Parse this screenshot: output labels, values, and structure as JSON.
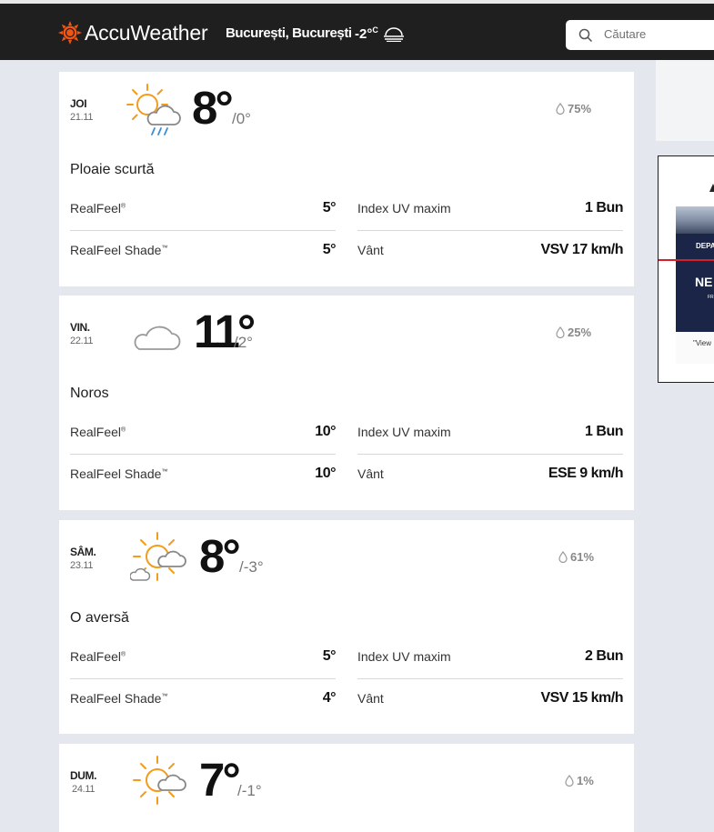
{
  "header": {
    "brand": "AccuWeather",
    "location": "București, București",
    "current_temp": "-2°",
    "current_unit": "C",
    "search_placeholder": "Căutare"
  },
  "ad": {
    "band_text": "DEPA",
    "headline": "NE",
    "sub": "FR",
    "footer": "\"View"
  },
  "days": [
    {
      "name": "JOI",
      "date": "21.11",
      "icon": "partly-sunny-rain-icon",
      "high": "8°",
      "low": "/0°",
      "precip": "75%",
      "phrase": "Ploaie scurtă",
      "realfeel_label": "RealFeel",
      "realfeel_sup": "®",
      "realfeel": "5°",
      "shade_label": "RealFeel Shade",
      "shade_sup": "™",
      "shade": "5°",
      "uv_label": "Index UV maxim",
      "uv": "1 Bun",
      "wind_label": "Vânt",
      "wind": "VSV 17 km/h"
    },
    {
      "name": "VIN.",
      "date": "22.11",
      "icon": "cloud-icon",
      "high": "11°",
      "low": "/2°",
      "precip": "25%",
      "phrase": "Noros",
      "realfeel_label": "RealFeel",
      "realfeel_sup": "®",
      "realfeel": "10°",
      "shade_label": "RealFeel Shade",
      "shade_sup": "™",
      "shade": "10°",
      "uv_label": "Index UV maxim",
      "uv": "1 Bun",
      "wind_label": "Vânt",
      "wind": "ESE 9 km/h"
    },
    {
      "name": "SÂM.",
      "date": "23.11",
      "icon": "partly-sunny-showers-icon",
      "high": "8°",
      "low": "/-3°",
      "precip": "61%",
      "phrase": "O aversă",
      "realfeel_label": "RealFeel",
      "realfeel_sup": "®",
      "realfeel": "5°",
      "shade_label": "RealFeel Shade",
      "shade_sup": "™",
      "shade": "4°",
      "uv_label": "Index UV maxim",
      "uv": "2 Bun",
      "wind_label": "Vânt",
      "wind": "VSV 15 km/h"
    },
    {
      "name": "DUM.",
      "date": "24.11",
      "icon": "partly-sunny-icon",
      "high": "7°",
      "low": "/-1°",
      "precip": "1%"
    }
  ]
}
